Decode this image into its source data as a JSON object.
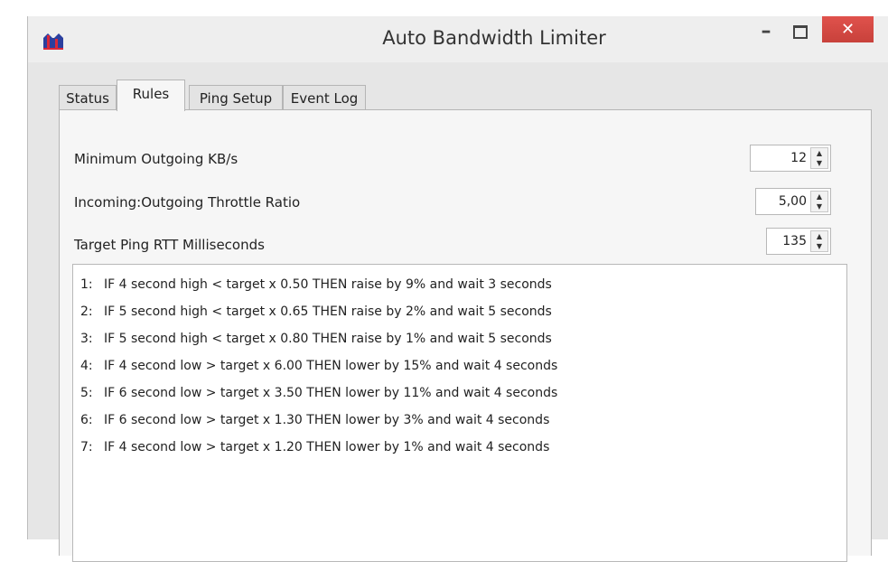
{
  "window": {
    "title": "Auto Bandwidth Limiter",
    "icon": "app-icon",
    "controls": {
      "minimize": "–",
      "maximize": "maximize-icon",
      "close": "✕"
    }
  },
  "tabs": [
    {
      "label": "Status",
      "active": false
    },
    {
      "label": "Rules",
      "active": true
    },
    {
      "label": "Ping Setup",
      "active": false
    },
    {
      "label": "Event Log",
      "active": false
    }
  ],
  "settings": {
    "min_outgoing": {
      "label": "Minimum Outgoing KB/s",
      "value": "12"
    },
    "throttle_ratio": {
      "label": "Incoming:Outgoing Throttle Ratio",
      "value": "5,00"
    },
    "target_ping": {
      "label": "Target Ping RTT Milliseconds",
      "value": "135"
    }
  },
  "rules": [
    {
      "num": "1:",
      "text": "IF 4 second high < target x 0.50 THEN raise by 9% and wait 3 seconds"
    },
    {
      "num": "2:",
      "text": "IF 5 second high < target x 0.65 THEN raise by 2% and wait 5 seconds"
    },
    {
      "num": "3:",
      "text": "IF 5 second high < target x 0.80 THEN raise by 1% and wait 5 seconds"
    },
    {
      "num": "4:",
      "text": "IF 4 second low > target x 6.00 THEN lower by 15% and wait 4 seconds"
    },
    {
      "num": "5:",
      "text": "IF 6 second low > target x 3.50 THEN lower by 11% and wait 4 seconds"
    },
    {
      "num": "6:",
      "text": "IF 6 second low > target x 1.30 THEN lower by 3% and wait 4 seconds"
    },
    {
      "num": "7:",
      "text": "IF 4 second low > target x 1.20 THEN lower by 1% and wait 4 seconds"
    }
  ],
  "colors": {
    "close_button": "#d9534f",
    "window_bg": "#e6e6e6",
    "panel_bg": "#f6f6f6"
  }
}
